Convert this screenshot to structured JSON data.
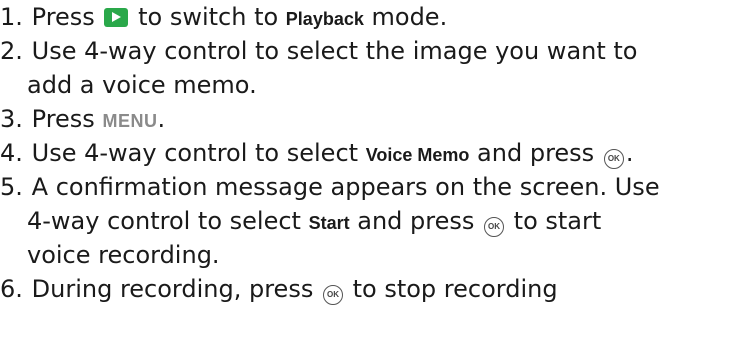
{
  "icons": {
    "playback": "playback-icon",
    "ok": "ok-button-icon"
  },
  "colors": {
    "playback_icon": "#2aa84a",
    "menu_text": "#8a8a8a"
  },
  "steps": [
    {
      "num": "1.",
      "pre": "Press",
      "ui": "Playback",
      "post": "to switch to",
      "end": "mode."
    },
    {
      "num": "2.",
      "line1": "Use 4-way control to select the image you want to",
      "line2": "add a voice memo."
    },
    {
      "num": "3.",
      "pre": "Press",
      "ui": "MENU",
      "end": "."
    },
    {
      "num": "4.",
      "pre": "Use 4-way control to select",
      "ui": "Voice Memo",
      "mid": "and press",
      "end": "."
    },
    {
      "num": "5.",
      "line1": "A confirmation message appears on the screen. Use",
      "line2_pre": "4-way control to select",
      "ui": "Start",
      "line2_mid": "and press",
      "line2_post": "to start",
      "line3": "voice recording."
    },
    {
      "num": "6.",
      "pre": "During recording, press",
      "post": "to stop recording"
    }
  ],
  "ok_label": "OK"
}
